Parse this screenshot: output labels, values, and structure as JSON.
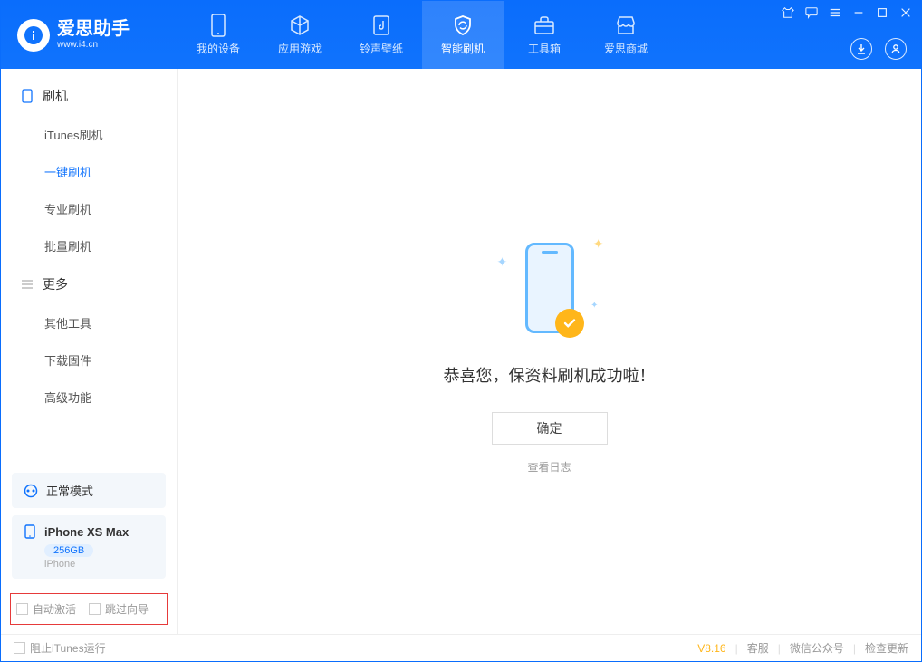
{
  "app": {
    "title": "爱思助手",
    "subtitle": "www.i4.cn"
  },
  "nav": {
    "tabs": [
      {
        "label": "我的设备"
      },
      {
        "label": "应用游戏"
      },
      {
        "label": "铃声壁纸"
      },
      {
        "label": "智能刷机"
      },
      {
        "label": "工具箱"
      },
      {
        "label": "爱思商城"
      }
    ]
  },
  "sidebar": {
    "section1": {
      "title": "刷机",
      "items": [
        "iTunes刷机",
        "一键刷机",
        "专业刷机",
        "批量刷机"
      ]
    },
    "section2": {
      "title": "更多",
      "items": [
        "其他工具",
        "下载固件",
        "高级功能"
      ]
    }
  },
  "mode": {
    "label": "正常模式"
  },
  "device": {
    "name": "iPhone XS Max",
    "storage": "256GB",
    "type": "iPhone"
  },
  "options": {
    "auto_activate": "自动激活",
    "skip_wizard": "跳过向导"
  },
  "main": {
    "message": "恭喜您，保资料刷机成功啦！",
    "ok": "确定",
    "view_log": "查看日志"
  },
  "status": {
    "block_itunes": "阻止iTunes运行",
    "version": "V8.16",
    "support": "客服",
    "wechat": "微信公众号",
    "update": "检查更新"
  }
}
